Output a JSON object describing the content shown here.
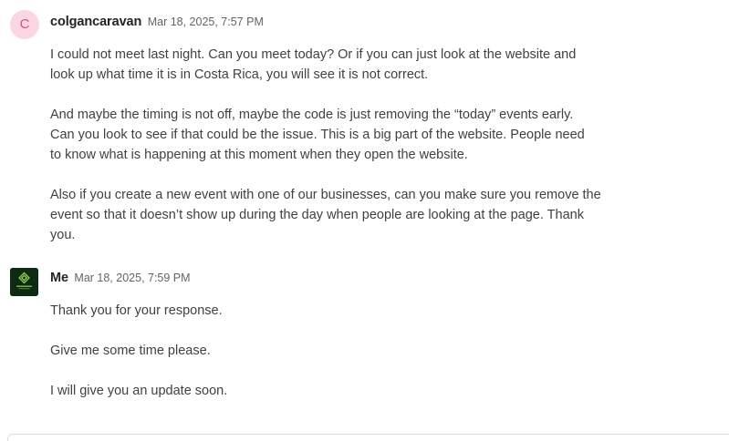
{
  "messages": [
    {
      "avatar_letter": "C",
      "avatar_color": "#fad7e3",
      "username": "colgancaravan",
      "timestamp": "Mar 18, 2025, 7:57 PM",
      "paragraphs": [
        "I could not meet last night.  Can you meet today?  Or if you can just look at the website and\nlook up what time it is in Costa Rica, you will see it is not correct.",
        "And maybe the timing is not off, maybe the code is just removing the “today” events early.\nCan you look to see if that could be the issue.  This is a big part of the website.  People need\nto know what is happening at this moment when they open the website.",
        "Also if you create a new event with one of our businesses, can you make sure you remove the\nevent so that it doesn’t show up during the day when people are looking at the page. Thank\nyou."
      ]
    },
    {
      "avatar_icon": "brand-logo-icon",
      "avatar_color": "#0f2a12",
      "username": "Me",
      "timestamp": "Mar 18, 2025, 7:59 PM",
      "paragraphs": [
        "Thank you for your response.",
        "Give me some time please.",
        "I will give you an update soon."
      ]
    }
  ]
}
